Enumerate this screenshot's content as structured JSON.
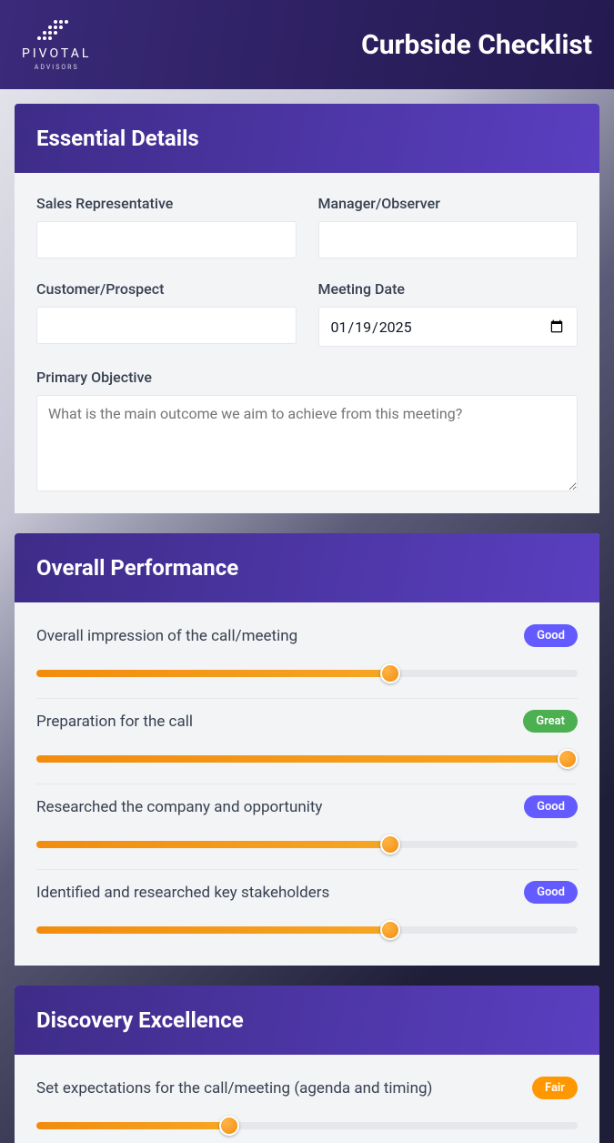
{
  "header": {
    "brand": "PIVOTAL",
    "brand_sub": "ADVISORS",
    "title": "Curbside Checklist"
  },
  "sections": {
    "essential": {
      "title": "Essential Details",
      "fields": {
        "sales_rep_label": "Sales Representative",
        "sales_rep_value": "",
        "manager_label": "Manager/Observer",
        "manager_value": "",
        "customer_label": "Customer/Prospect",
        "customer_value": "",
        "date_label": "Meeting Date",
        "date_value": "2025-01-19",
        "objective_label": "Primary Objective",
        "objective_placeholder": "What is the main outcome we aim to achieve from this meeting?",
        "objective_value": ""
      }
    },
    "overall": {
      "title": "Overall Performance",
      "items": [
        {
          "label": "Overall impression of the call/meeting",
          "rating": "Good",
          "rating_class": "good",
          "value": 66
        },
        {
          "label": "Preparation for the call",
          "rating": "Great",
          "rating_class": "great",
          "value": 100
        },
        {
          "label": "Researched the company and opportunity",
          "rating": "Good",
          "rating_class": "good",
          "value": 66
        },
        {
          "label": "Identified and researched key stakeholders",
          "rating": "Good",
          "rating_class": "good",
          "value": 66
        }
      ]
    },
    "discovery": {
      "title": "Discovery Excellence",
      "items": [
        {
          "label": "Set expectations for the call/meeting (agenda and timing)",
          "rating": "Fair",
          "rating_class": "fair",
          "value": 35
        }
      ]
    }
  }
}
